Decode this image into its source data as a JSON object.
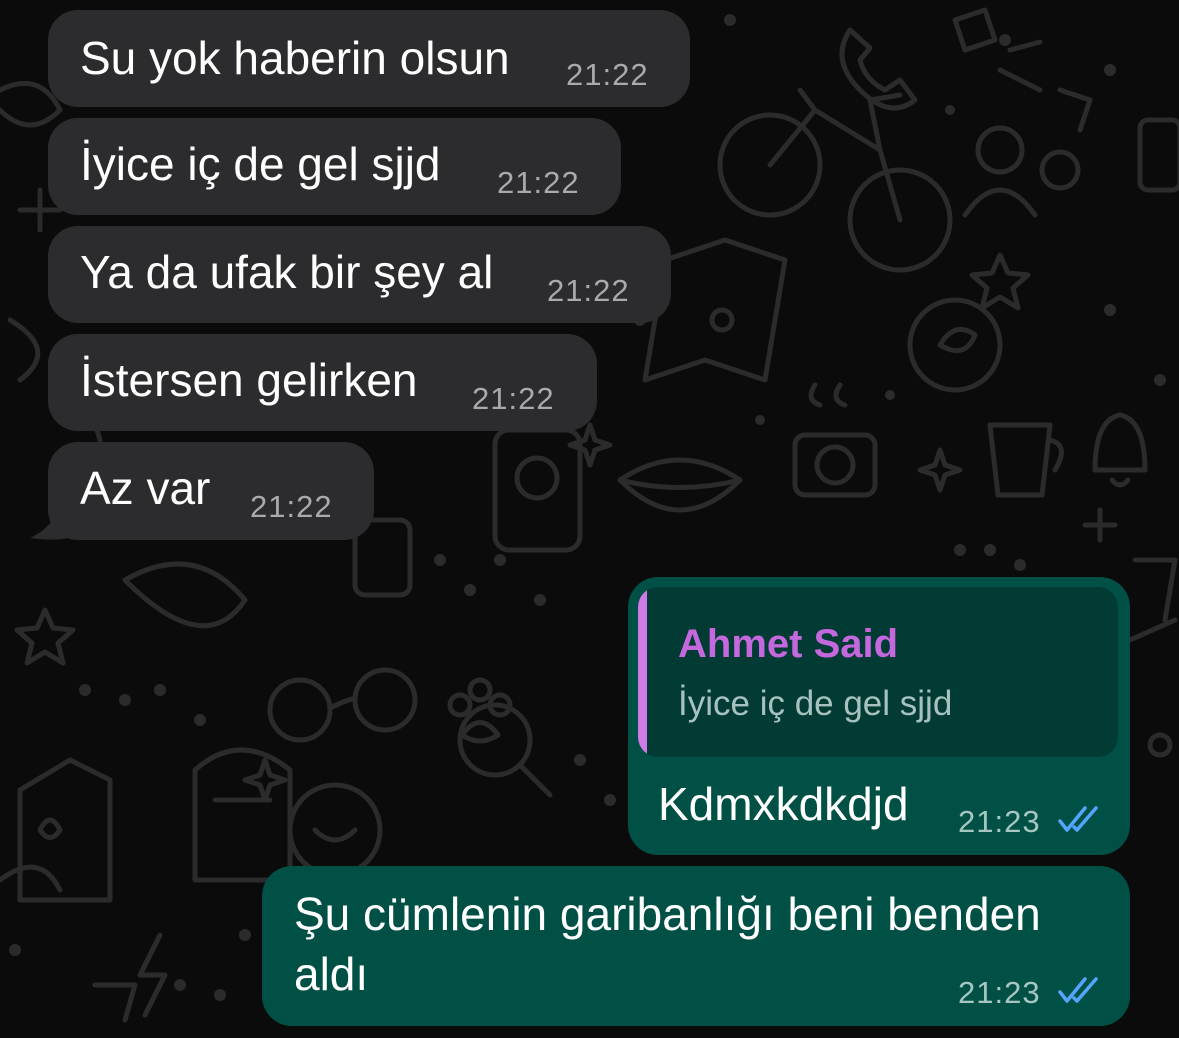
{
  "chat": {
    "incoming": [
      {
        "text": "Su yok haberin olsun",
        "time": "21:22"
      },
      {
        "text": "İyice iç de gel sjjd",
        "time": "21:22"
      },
      {
        "text": "Ya da ufak bir şey al",
        "time": "21:22"
      },
      {
        "text": "İstersen gelirken",
        "time": "21:22"
      },
      {
        "text": "Az var",
        "time": "21:22"
      }
    ],
    "outgoing": [
      {
        "quote_author": "Ahmet Said",
        "quote_text": "İyice iç de gel sjjd",
        "text": "Kdmxkdkdjd",
        "time": "21:23",
        "status": "read"
      },
      {
        "text": "Şu cümlenin garibanlığı beni benden aldı",
        "time": "21:23",
        "status": "read"
      }
    ]
  },
  "colors": {
    "incoming_bubble": "#2c2c2e",
    "outgoing_bubble": "#005046",
    "quote_accent": "#c568dd",
    "read_ticks": "#53a6fb"
  },
  "icons": {
    "read_receipt": "double-check-icon",
    "wallpaper": "doodle-pattern"
  }
}
